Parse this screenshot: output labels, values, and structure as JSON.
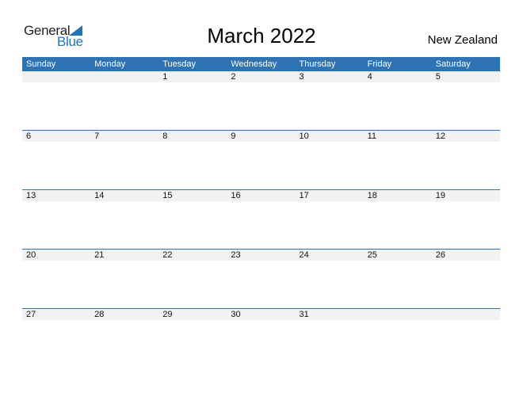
{
  "logo": {
    "word1": "General",
    "word2": "Blue",
    "icon": "triangle-flag-icon",
    "accent": "#1f73c0"
  },
  "title": "March 2022",
  "country": "New Zealand",
  "header_color": "#2e73b6",
  "weekdays": [
    "Sunday",
    "Monday",
    "Tuesday",
    "Wednesday",
    "Thursday",
    "Friday",
    "Saturday"
  ],
  "weeks": [
    [
      "",
      "",
      "1",
      "2",
      "3",
      "4",
      "5"
    ],
    [
      "6",
      "7",
      "8",
      "9",
      "10",
      "11",
      "12"
    ],
    [
      "13",
      "14",
      "15",
      "16",
      "17",
      "18",
      "19"
    ],
    [
      "20",
      "21",
      "22",
      "23",
      "24",
      "25",
      "26"
    ],
    [
      "27",
      "28",
      "29",
      "30",
      "31",
      "",
      ""
    ]
  ]
}
